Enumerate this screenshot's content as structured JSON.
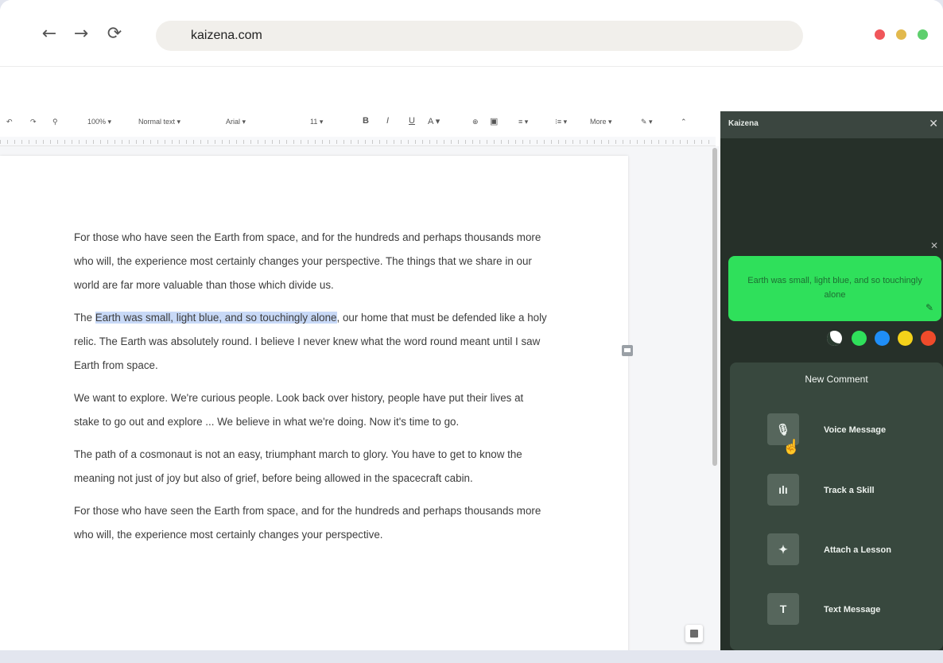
{
  "browser": {
    "url": "kaizena.com",
    "nav_back_icon": "←",
    "nav_forward_icon": "→",
    "reload_icon": "⟳",
    "window_dots": [
      "#f0565a",
      "#e2b94d",
      "#5ecf6d"
    ]
  },
  "docs_toolbar": {
    "undo": "↶",
    "redo": "↷",
    "paint_format": "⚲",
    "zoom": "100% ▾",
    "style": "Normal text ▾",
    "font": "Arial ▾",
    "size": "11 ▾",
    "bold": "B",
    "italic": "I",
    "underline": "U",
    "text_color": "A ▾",
    "link": "⊕",
    "comment": "▣",
    "align": "≡ ▾",
    "line_spacing": "⁝≡ ▾",
    "more": "More ▾",
    "edit_mode": "✎ ▾",
    "collapse": "⌃"
  },
  "document": {
    "paragraphs": [
      {
        "text": "For those who have seen the Earth from space, and for the hundreds and perhaps thousands more who will, the experience most certainly changes your perspective. The things that we share in our world are far more valuable than those which divide us."
      },
      {
        "prefix": "The ",
        "highlight": "Earth was small, light blue, and so touchingly alone",
        "suffix": ", our home that must be defended like a holy relic. The Earth was absolutely round. I believe I never knew what the word round meant until I saw Earth from space."
      },
      {
        "text": "We want to explore. We're curious people. Look back over history, people have put their lives at stake to go out and explore ... We believe in what we're doing. Now it's time to go."
      },
      {
        "text": "The path of a cosmonaut is not an easy, triumphant march to glory. You have to get to know the meaning not just of joy but also of grief, before being allowed in the spacecraft cabin."
      },
      {
        "text": "For those who have seen the Earth from space, and for the hundreds and perhaps thousands more who will, the experience most certainly changes your perspective."
      }
    ]
  },
  "panel": {
    "title": "Kaizena",
    "close_icon": "✕",
    "highlight_text": "Earth was small, light blue, and so touchingly alone",
    "card_close_icon": "✕",
    "pen_icon": "✎",
    "colors": [
      "#2fe05b",
      "#1f8ef7",
      "#f4d21a",
      "#ef4b2b"
    ],
    "new_comment_label": "New Comment",
    "options": [
      {
        "label": "Voice Message",
        "icon": "🎙"
      },
      {
        "label": "Track a Skill",
        "icon": "ılı"
      },
      {
        "label": "Attach a Lesson",
        "icon": "✦"
      },
      {
        "label": "Text Message",
        "icon": "T"
      }
    ]
  }
}
